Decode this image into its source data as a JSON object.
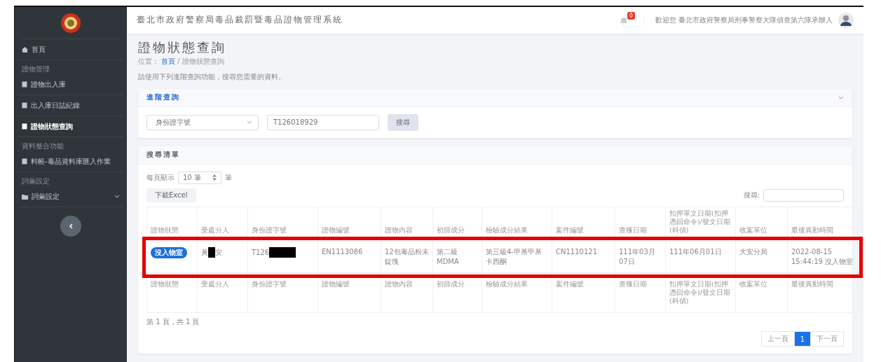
{
  "app_title": "臺北市政府警察局毒品裁罰暨毒品證物管理系統",
  "header": {
    "notification_count": "0",
    "user_text": "歡迎您 臺北市政府警察局刑事警察大隊偵查第六隊承辦人"
  },
  "sidebar": {
    "items": [
      {
        "kind": "item",
        "label": "首頁",
        "selected": false
      },
      {
        "kind": "section",
        "label": "證物管理"
      },
      {
        "kind": "item",
        "label": "證物出入庫",
        "selected": false
      },
      {
        "kind": "item",
        "label": "出入庫日誌紀錄",
        "selected": false
      },
      {
        "kind": "item",
        "label": "證物狀態查詢",
        "selected": true
      },
      {
        "kind": "section",
        "label": "資料整合功能"
      },
      {
        "kind": "item",
        "label": "料帳-毒品資料庫匯入作業",
        "selected": false
      },
      {
        "kind": "section",
        "label": "詞彙設定"
      },
      {
        "kind": "group",
        "label": "詞彙設定",
        "selected": false,
        "expanded": false
      }
    ]
  },
  "page": {
    "title": "證物狀態查詢",
    "breadcrumb": {
      "prefix": "位置：",
      "home": "首頁",
      "current": "/ 證物狀態查詢"
    },
    "description": "請使用下列進階查詢功能，搜尋您需要的資料。"
  },
  "query_card": {
    "title": "進階查詢",
    "field_select": "身份證字號",
    "search_value": "T126018929",
    "search_button": "搜尋"
  },
  "results_card": {
    "title": "搜尋清單",
    "page_size_label": "每頁顯示",
    "page_size": "10 筆",
    "page_size_unit": "筆",
    "export_button": "下載Excel",
    "search_label": "搜尋:",
    "table": {
      "columns": [
        "證物狀態",
        "受處分人",
        "身份證字號",
        "證物編號",
        "證物內容",
        "初篩成分",
        "檢驗成分結果",
        "案件編號",
        "查獲日期",
        "扣押單文日期(扣押憑回命令)/發文日期(科偵)",
        "收案單位",
        "最後異動時間"
      ],
      "footer_columns": [
        "證物狀態",
        "受處分人",
        "身份證字號",
        "證物編號",
        "證物內容",
        "初篩成分",
        "檢驗成分結果",
        "案件編號",
        "查獲日期",
        "扣押單文日期(扣押憑回命令)/發文日期(科偵)",
        "收案單位",
        "最後異動時間"
      ],
      "rows": [
        {
          "highlighted": true,
          "status": "沒入物室",
          "subject": {
            "before": "黃",
            "after": "安"
          },
          "id_number": "T126",
          "evidence_no": "EN1113086",
          "content": "12包毒品粉末錠塊",
          "screening": "第二級 MDMA",
          "test_result": "第三級4-甲基甲基卡西酮",
          "case_no": "CN1110121",
          "seized_date": "111年03月07日",
          "doc_date": "111年06月01日",
          "unit": "大安分局",
          "last_modified": "2022-08-15 15:44:19 沒入物室"
        }
      ]
    },
    "page_info": "第 1 頁，共 1 頁",
    "pagination": [
      {
        "label": "上一頁",
        "selected": false
      },
      {
        "label": "1",
        "selected": true
      },
      {
        "label": "下一頁",
        "selected": false
      }
    ]
  }
}
